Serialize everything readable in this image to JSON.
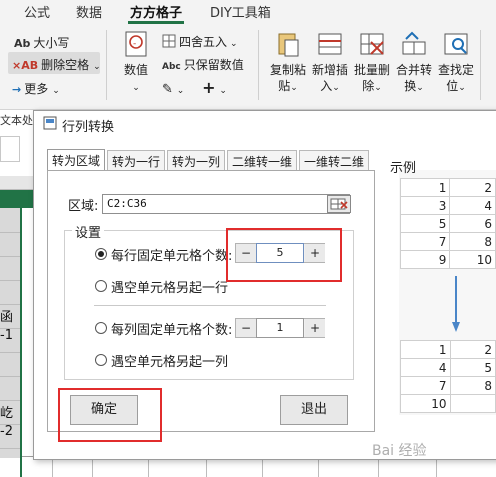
{
  "ribbon": {
    "tabs": [
      "公式",
      "数据",
      "方方格子",
      "DIY工具箱"
    ],
    "active_tab": "方方格子",
    "small_buttons": {
      "case": "大小写",
      "case_icon_text": "Ab",
      "remove_space": "删除空格",
      "remove_space_icon_text": "×AB",
      "more": "更多",
      "round": "四舍五入",
      "keep_value": "只保留数值",
      "keep_value_icon_text": "Abc"
    },
    "big_buttons": {
      "number": "数值",
      "copy_paste": [
        "复制粘",
        "贴"
      ],
      "insert": [
        "新增插",
        "入"
      ],
      "batch_delete": [
        "批量删",
        "除"
      ],
      "merge": [
        "合并转",
        "换"
      ],
      "locate": [
        "查找定",
        "位"
      ]
    },
    "accent_color": "#217346"
  },
  "sheet": {
    "formula_fragment": "文本处",
    "cell_texts": [
      "函",
      "-1",
      "屹",
      "-2"
    ]
  },
  "dialog": {
    "title": "行列转换",
    "tabs": [
      "转为区域",
      "转为一行",
      "转为一列",
      "二维转一维",
      "一维转二维"
    ],
    "active_tab": "转为区域",
    "range_label": "区域:",
    "range_value": "C2:C36",
    "group_title": "设置",
    "options": {
      "per_row_fixed": "每行固定单元格个数:",
      "per_row_value": "5",
      "row_on_empty": "遇空单元格另起一行",
      "per_col_fixed": "每列固定单元格个数:",
      "per_col_value": "1",
      "col_on_empty": "遇空单元格另起一列"
    },
    "selected_option": "per_row_fixed",
    "stepper_minus": "−",
    "stepper_plus": "+",
    "ok_button": "确定",
    "exit_button": "退出",
    "example_label": "示例",
    "example_top": [
      [
        "1",
        "2"
      ],
      [
        "3",
        "4"
      ],
      [
        "5",
        "6"
      ],
      [
        "7",
        "8"
      ],
      [
        "9",
        "10"
      ]
    ],
    "example_bottom": [
      [
        "1",
        "2"
      ],
      [
        "4",
        "5"
      ],
      [
        "7",
        "8"
      ],
      [
        "10",
        ""
      ]
    ],
    "highlight_color": "#e12c2c"
  },
  "watermark": "Bai 经验"
}
